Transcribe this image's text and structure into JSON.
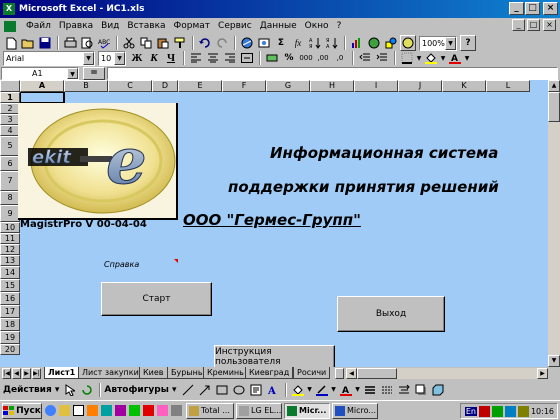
{
  "window": {
    "title": "Microsoft Excel - ИС1.xls",
    "minimize_glyph": "_",
    "maximize_glyph": "□",
    "close_glyph": "×"
  },
  "menu": {
    "items": [
      "Файл",
      "Правка",
      "Вид",
      "Вставка",
      "Формат",
      "Сервис",
      "Данные",
      "Окно",
      "?"
    ]
  },
  "toolbar": {
    "zoom": "100%",
    "sum_glyph": "Σ",
    "fx_glyph": "fx",
    "percent": "%",
    "bold": "Ж",
    "italic": "К",
    "underline": "Ч",
    "help": "?"
  },
  "format_toolbar": {
    "font_name": "Arial",
    "font_size": "10",
    "comma_style": "000",
    "increase_decimal": ",00",
    "decrease_decimal": ",0"
  },
  "formula_bar": {
    "cell_ref": "A1",
    "equals": "=",
    "value": ""
  },
  "grid": {
    "columns": [
      "A",
      "B",
      "C",
      "D",
      "E",
      "F",
      "G",
      "H",
      "I",
      "J",
      "K",
      "L"
    ],
    "rows": [
      "1",
      "2",
      "3",
      "4",
      "5",
      "6",
      "7",
      "8",
      "9",
      "10",
      "11",
      "12",
      "13",
      "14",
      "15",
      "16",
      "17",
      "18",
      "19",
      "20"
    ],
    "background": "#9fcbf6"
  },
  "content": {
    "logo_text": "ekit",
    "logo_letter": "e",
    "title_line1": "Информационная система",
    "title_line2": "поддержки принятия решений",
    "version": "MagistrPro V 00-04-04",
    "company": "ООО \"Гермес-Групп\"",
    "help_link": "Справка",
    "start_button": "Старт",
    "exit_button": "Выход",
    "manual_button": "Инструкция пользователя"
  },
  "sheet_tabs": {
    "active": "Лист1",
    "tabs": [
      "Лист1",
      "Лист закупки",
      "Киев",
      "Бурынь",
      "Креминь",
      "Киевград",
      "Росичи"
    ]
  },
  "draw_toolbar": {
    "actions": "Действия",
    "autoshapes": "Автофигуры"
  },
  "taskbar": {
    "start": "Пуск",
    "tasks": [
      "Total ...",
      "LG EL...",
      "Micr...",
      "Micro..."
    ],
    "active_task": "Micr...",
    "lang": "En",
    "time": "10:16"
  },
  "colors": {
    "titlebar_start": "#000080",
    "titlebar_end": "#1084d0",
    "sheet_background": "#9fcbf6",
    "help_marker": "#e00000"
  }
}
